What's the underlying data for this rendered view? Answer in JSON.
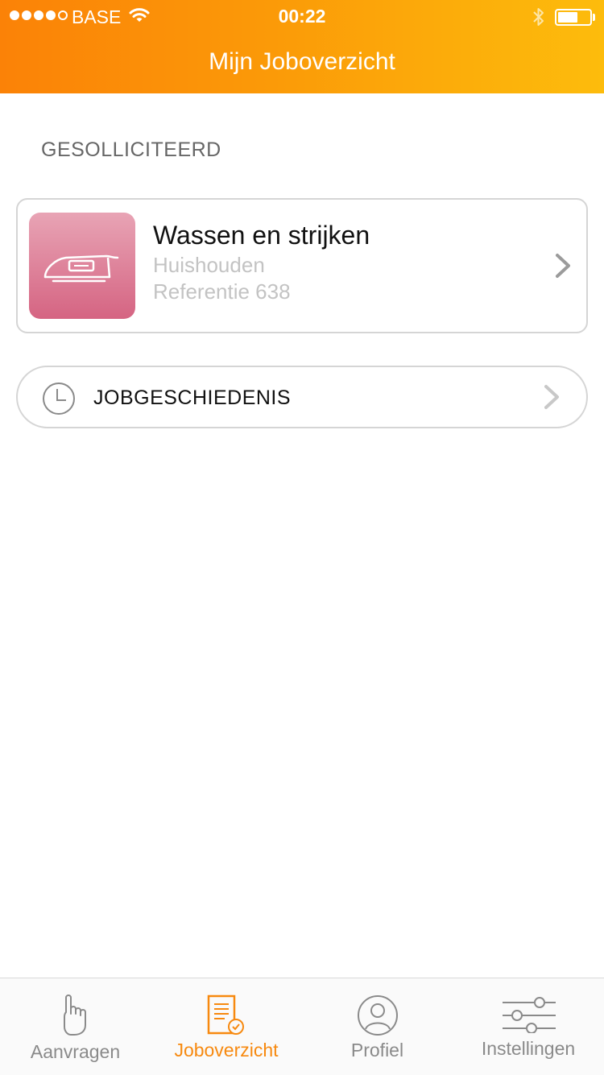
{
  "status_bar": {
    "carrier": "BASE",
    "time": "00:22",
    "icons": [
      "signal-dots-icon",
      "wifi-icon",
      "bluetooth-icon",
      "battery-icon"
    ]
  },
  "header": {
    "title": "Mijn Joboverzicht"
  },
  "section": {
    "label": "GESOLLICITEERD"
  },
  "job": {
    "title": "Wassen en strijken",
    "category": "Huishouden",
    "reference": "Referentie 638",
    "icon": "iron-icon"
  },
  "history": {
    "label": "JOBGESCHIEDENIS",
    "icon": "clock-icon"
  },
  "tabs": [
    {
      "label": "Aanvragen",
      "icon": "hand-icon",
      "active": false
    },
    {
      "label": "Joboverzicht",
      "icon": "document-check-icon",
      "active": true
    },
    {
      "label": "Profiel",
      "icon": "user-icon",
      "active": false
    },
    {
      "label": "Instellingen",
      "icon": "sliders-icon",
      "active": false
    }
  ],
  "colors": {
    "header_gradient_start": "#fb8207",
    "header_gradient_end": "#fdbc0c",
    "accent": "#f7890f",
    "card_thumb_top": "#e8a4b5",
    "card_thumb_bottom": "#d56482"
  }
}
